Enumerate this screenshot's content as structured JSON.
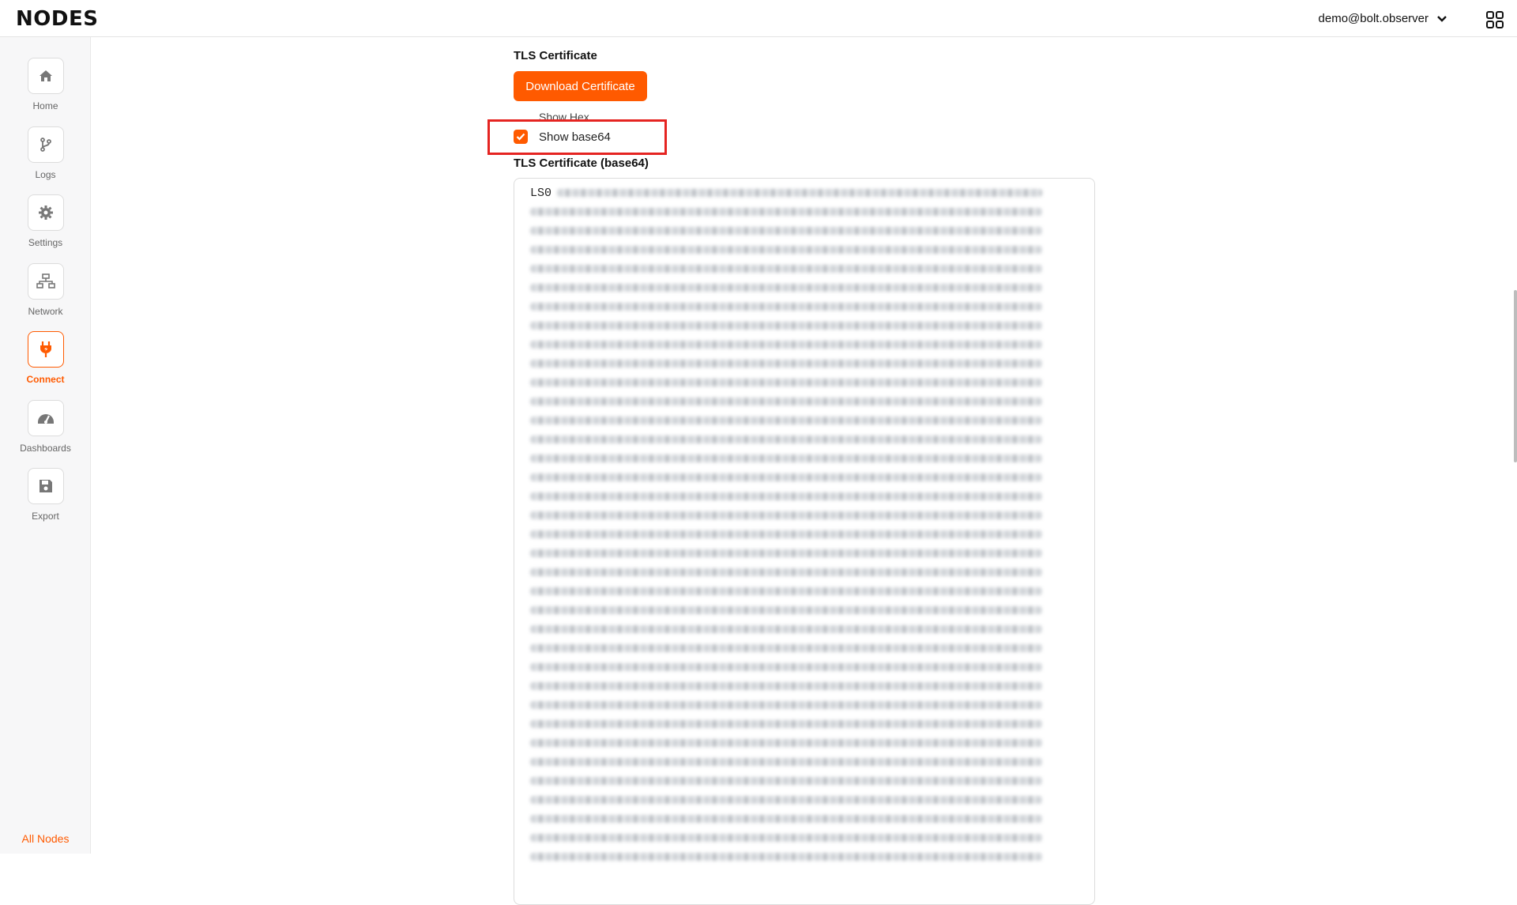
{
  "app": {
    "logo": "NODES"
  },
  "header": {
    "user_email": "demo@bolt.observer"
  },
  "sidebar": {
    "items": [
      {
        "label": "Home",
        "icon": "home-icon"
      },
      {
        "label": "Logs",
        "icon": "branch-icon"
      },
      {
        "label": "Settings",
        "icon": "gear-icon"
      },
      {
        "label": "Network",
        "icon": "network-icon"
      },
      {
        "label": "Connect",
        "icon": "plug-icon",
        "active": true
      },
      {
        "label": "Dashboards",
        "icon": "gauge-icon"
      },
      {
        "label": "Export",
        "icon": "save-icon"
      }
    ],
    "footer_link": "All Nodes"
  },
  "main": {
    "section_title": "TLS Certificate",
    "download_button": "Download Certificate",
    "options": {
      "show_hex": "Show Hex",
      "show_base64": "Show base64",
      "show_base64_checked": true
    },
    "textarea_title": "TLS Certificate (base64)",
    "textarea_value": "LS0"
  },
  "colors": {
    "accent": "#ff5a00",
    "highlight": "#e52421"
  }
}
